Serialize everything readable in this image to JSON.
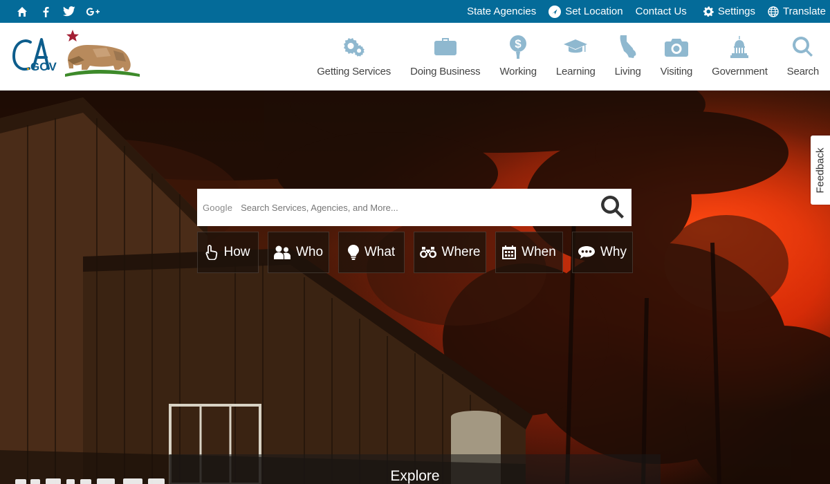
{
  "utility_bar": {
    "links": {
      "state_agencies": "State Agencies",
      "set_location": "Set Location",
      "contact_us": "Contact Us",
      "settings": "Settings",
      "translate": "Translate"
    },
    "social_icons": [
      "home-icon",
      "facebook-icon",
      "twitter-icon",
      "google-plus-icon"
    ],
    "background_color": "#046b99"
  },
  "header": {
    "logo_text": "CA.GOV",
    "nav": [
      {
        "label": "Getting Services",
        "icon": "gears-icon"
      },
      {
        "label": "Doing Business",
        "icon": "briefcase-icon"
      },
      {
        "label": "Working",
        "icon": "money-bag-icon"
      },
      {
        "label": "Learning",
        "icon": "graduation-cap-icon"
      },
      {
        "label": "Living",
        "icon": "california-icon"
      },
      {
        "label": "Visiting",
        "icon": "camera-icon"
      },
      {
        "label": "Government",
        "icon": "capitol-icon"
      },
      {
        "label": "Search",
        "icon": "search-icon"
      }
    ],
    "nav_icon_color": "#8fb8cf"
  },
  "search": {
    "provider_label": "Google",
    "placeholder": "Search Services, Agencies, and More..."
  },
  "questions": [
    {
      "label": "How",
      "icon": "touch-icon"
    },
    {
      "label": "Who",
      "icon": "people-icon"
    },
    {
      "label": "What",
      "icon": "lightbulb-icon"
    },
    {
      "label": "Where",
      "icon": "binoculars-icon"
    },
    {
      "label": "When",
      "icon": "calendar-icon"
    },
    {
      "label": "Why",
      "icon": "speech-bubble-icon"
    }
  ],
  "feedback_label": "Feedback",
  "explore_label": "Explore"
}
